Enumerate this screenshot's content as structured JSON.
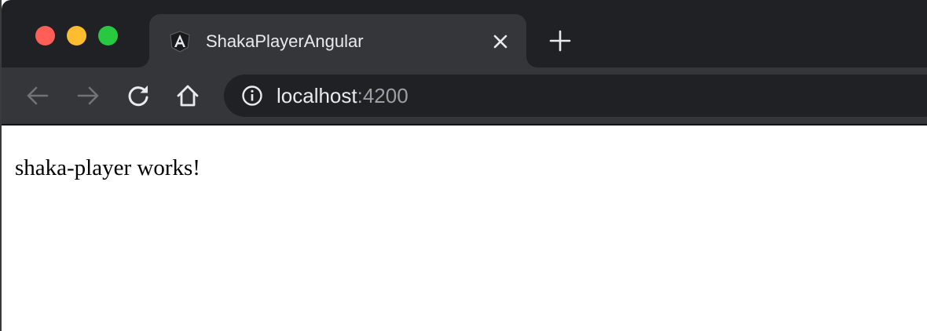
{
  "browser": {
    "window_controls": {
      "close_color": "#ff5f57",
      "minimize_color": "#febc2e",
      "maximize_color": "#28c840"
    },
    "tab": {
      "title": "ShakaPlayerAngular",
      "favicon": "angular-logo-icon"
    },
    "toolbar": {
      "back_icon": "arrow-left-icon",
      "forward_icon": "arrow-right-icon",
      "reload_icon": "reload-icon",
      "home_icon": "home-icon",
      "info_icon": "info-circle-icon"
    },
    "address_bar": {
      "host": "localhost",
      "port": ":4200"
    },
    "colors": {
      "tab_strip": "#202124",
      "toolbar": "#35363a",
      "text": "#e8eaed",
      "muted_text": "#9aa0a6"
    }
  },
  "page": {
    "body_text": "shaka-player works!"
  }
}
